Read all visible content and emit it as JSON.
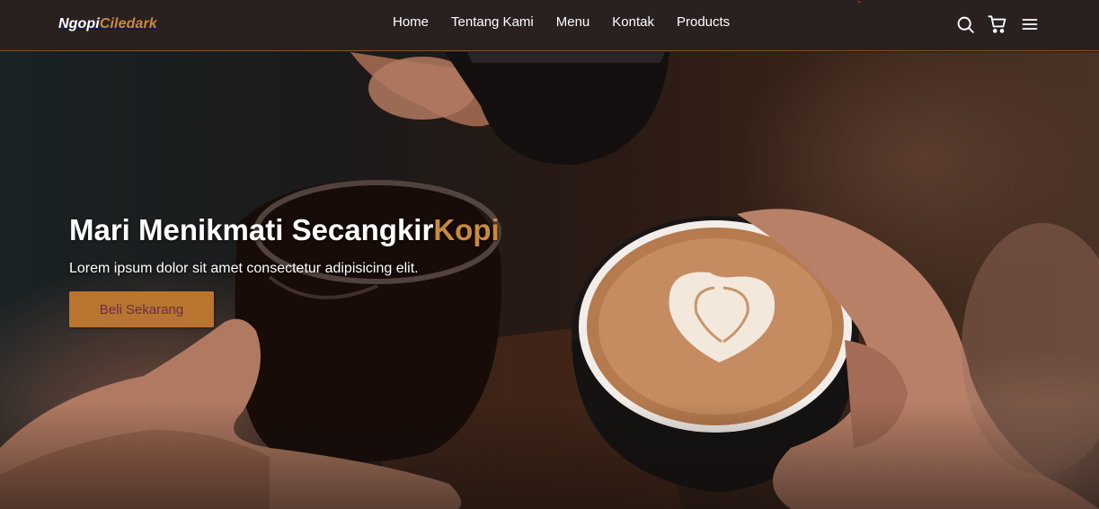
{
  "brand": {
    "name_part1": "Ngopi",
    "name_part2": "Ciledark",
    "accent_color": "#c98a3e"
  },
  "nav": {
    "links": [
      "Home",
      "Tentang Kami",
      "Menu",
      "Kontak",
      "Products"
    ],
    "icons": [
      "search-icon",
      "cart-icon",
      "menu-icon"
    ]
  },
  "hero": {
    "title_main": "Mari Menikmati Secangkir",
    "title_accent": "Kopi",
    "subtitle": "Lorem ipsum dolor sit amet consectetur adipisicing elit.",
    "cta_label": "Beli Sekarang",
    "cta_color": "#b9752f"
  }
}
